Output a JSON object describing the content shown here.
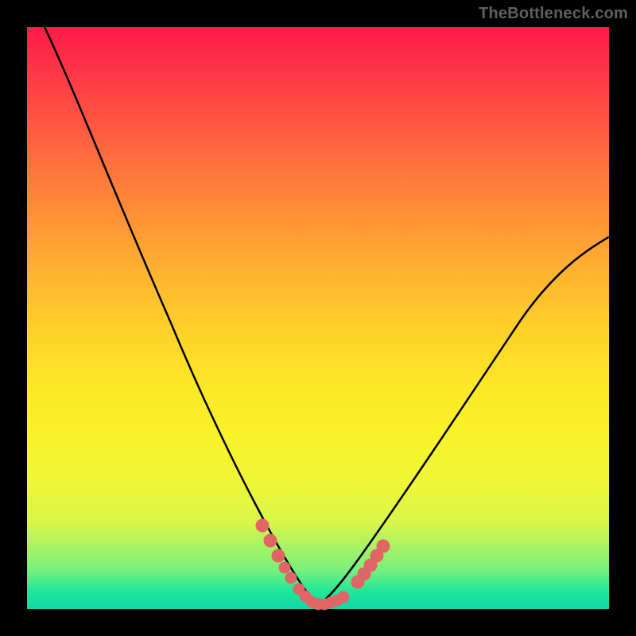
{
  "watermark": "TheBottleneck.com",
  "colors": {
    "frame_bg": "#000000",
    "watermark": "#5f5f5f",
    "curve": "#000000",
    "bead_fill": "#e06666",
    "gradient_top": "#ff1a49",
    "gradient_bottom": "#12d6a8"
  },
  "chart_data": {
    "type": "line",
    "title": "",
    "xlabel": "",
    "ylabel": "",
    "xlim": [
      0,
      100
    ],
    "ylim": [
      0,
      100
    ],
    "legend": false,
    "grid": false,
    "series": [
      {
        "name": "left-branch-curve",
        "x": [
          3,
          5,
          10,
          15,
          20,
          25,
          30,
          35,
          40,
          44,
          47,
          49,
          50
        ],
        "y": [
          100,
          95,
          82,
          69,
          56,
          44,
          33,
          23,
          14,
          8,
          4,
          1.5,
          0.6
        ]
      },
      {
        "name": "right-branch-curve",
        "x": [
          50,
          52,
          55,
          58,
          62,
          68,
          75,
          82,
          90,
          100
        ],
        "y": [
          0.6,
          1.2,
          2.8,
          5.0,
          9.0,
          16,
          26,
          37,
          49,
          64
        ]
      },
      {
        "name": "highlight-beads-scatter",
        "x": [
          40,
          42,
          43.5,
          44.5,
          45.5,
          47,
          48.2,
          49,
          50,
          51,
          52,
          53,
          54,
          56.5,
          57.5,
          58.5,
          59.5,
          60.5
        ],
        "y": [
          14,
          11,
          9.3,
          8.2,
          7.0,
          4.3,
          2.6,
          1.6,
          0.8,
          0.9,
          1.2,
          1.6,
          2.1,
          3.8,
          4.6,
          5.4,
          6.2,
          7.1
        ]
      }
    ],
    "annotations": [
      {
        "text": "TheBottleneck.com",
        "position": "top-right"
      }
    ]
  }
}
